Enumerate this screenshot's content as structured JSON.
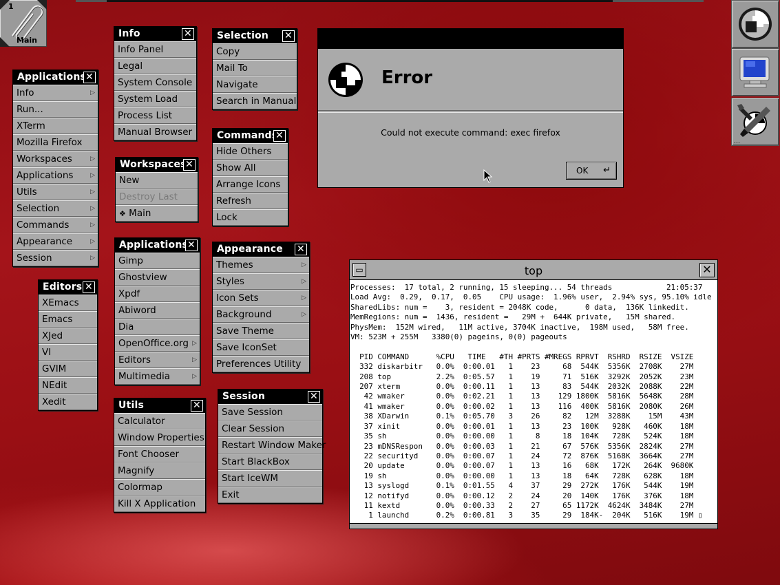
{
  "clip": {
    "workspace_number": "1",
    "workspace_name": "Main"
  },
  "menus": {
    "info": {
      "title": "Info",
      "items": [
        "Info Panel",
        "Legal",
        "System Console",
        "System Load",
        "Process List",
        "Manual Browser"
      ]
    },
    "selection": {
      "title": "Selection",
      "items": [
        "Copy",
        "Mail To",
        "Navigate",
        "Search in Manual"
      ]
    },
    "applications_root": {
      "title": "Applications",
      "items": [
        "Info",
        "Run...",
        "XTerm",
        "Mozilla Firefox",
        "Workspaces",
        "Applications",
        "Utils",
        "Selection",
        "Commands",
        "Appearance",
        "Session"
      ]
    },
    "commands": {
      "title": "Commands",
      "items": [
        "Hide Others",
        "Show All",
        "Arrange Icons",
        "Refresh",
        "Lock"
      ]
    },
    "workspaces": {
      "title": "Workspaces",
      "items": [
        "New",
        "Destroy Last",
        "Main"
      ],
      "current_marker": "❖"
    },
    "applications": {
      "title": "Applications",
      "items": [
        "Gimp",
        "Ghostview",
        "Xpdf",
        "Abiword",
        "Dia",
        "OpenOffice.org",
        "Editors",
        "Multimedia"
      ]
    },
    "appearance": {
      "title": "Appearance",
      "items": [
        "Themes",
        "Styles",
        "Icon Sets",
        "Background",
        "Save Theme",
        "Save IconSet",
        "Preferences Utility"
      ]
    },
    "editors": {
      "title": "Editors",
      "items": [
        "XEmacs",
        "Emacs",
        "XJed",
        "VI",
        "GVIM",
        "NEdit",
        "Xedit"
      ]
    },
    "utils": {
      "title": "Utils",
      "items": [
        "Calculator",
        "Window Properties",
        "Font Chooser",
        "Magnify",
        "Colormap",
        "Kill X Application"
      ]
    },
    "session": {
      "title": "Session",
      "items": [
        "Save Session",
        "Clear Session",
        "Restart Window Maker",
        "Start BlackBox",
        "Start IceWM",
        "Exit"
      ]
    }
  },
  "dialog": {
    "heading": "Error",
    "message": "Could not execute command: exec firefox",
    "ok_label": "OK",
    "return_glyph": "↵"
  },
  "terminal": {
    "title": "top",
    "header_lines": [
      "Processes:  17 total, 2 running, 15 sleeping... 54 threads            21:05:37",
      "Load Avg:  0.29,  0.17,  0.05    CPU usage:  1.96% user,  2.94% sys, 95.10% idle",
      "SharedLibs: num =    3, resident = 2048K code,      0 data,  136K linkedit.",
      "MemRegions: num =  1436, resident =   29M +  644K private,   15M shared.",
      "PhysMem:  152M wired,   11M active, 3704K inactive,  198M used,   58M free.",
      "VM: 523M + 255M   3380(0) pageins, 0(0) pageouts"
    ],
    "columns": "  PID COMMAND      %CPU   TIME   #TH #PRTS #MREGS RPRVT  RSHRD  RSIZE  VSIZE",
    "rows": [
      "  332 diskarbitr   0.0%  0:00.01   1    23     68  544K  5356K  2708K    27M",
      "  208 top          2.2%  0:05.57   1    19     71  516K  3292K  2052K    23M",
      "  207 xterm        0.0%  0:00.11   1    13     83  544K  2032K  2088K    22M",
      "   42 wmaker       0.0%  0:02.21   1    13    129 1800K  5816K  5648K    28M",
      "   41 wmaker       0.0%  0:00.02   1    13    116  400K  5816K  2080K    26M",
      "   38 XDarwin      0.1%  0:05.70   3    26     82   12M  3288K    15M    43M",
      "   37 xinit        0.0%  0:00.01   1    13     23  100K   928K   460K    18M",
      "   35 sh           0.0%  0:00.00   1     8     18  104K   728K   524K    18M",
      "   23 mDNSRespon   0.0%  0:00.03   1    21     67  576K  5356K  2824K    27M",
      "   22 securityd    0.0%  0:00.07   1    24     72  876K  5168K  3664K    27M",
      "   20 update       0.0%  0:00.07   1    13     16   68K   172K   264K  9680K",
      "   19 sh           0.0%  0:00.00   1    13     18   64K   728K   628K    18M",
      "   13 syslogd      0.1%  0:01.55   4    37     29  272K   176K   544K    19M",
      "   12 notifyd      0.0%  0:00.12   2    24     20  140K   176K   376K    18M",
      "   11 kextd        0.0%  0:00.33   2    27     65 1172K  4624K  3484K    27M",
      "    1 launchd      0.2%  0:00.81   3    35     29  184K-  204K   516K    19M ▯"
    ]
  }
}
